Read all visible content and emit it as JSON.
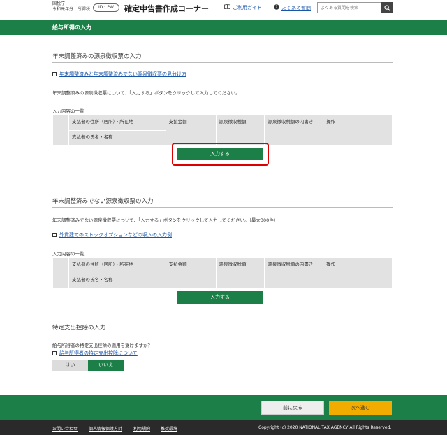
{
  "header": {
    "agency_line1": "国税庁",
    "agency_line2": "令和元年分　所得税",
    "idpw_badge": "ID・PW",
    "title": "確定申告書作成コーナー",
    "guide_link": "ご利用ガイド",
    "faq_link": "よくある質問",
    "search_placeholder": "よくある質問を検索"
  },
  "page_title": "給与所得の入力",
  "section1": {
    "title": "年末調整済みの源泉徴収票の入力",
    "guide_link": "年末調整済みと年末調整済みでない源泉徴収票の見分け方",
    "instruction": "年末調整済みの源泉徴収票について、「入力する」ボタンをクリックして入力してください。",
    "list_label": "入力内容の一覧",
    "enter_button": "入力する"
  },
  "section2": {
    "title": "年末調整済みでない源泉徴収票の入力",
    "instruction": "年末調整済みでない源泉徴収票について、「入力する」ボタンをクリックして入力してください。（最大300件）",
    "guide_link": "外貨建てのストックオプションなどの収入の入力例",
    "list_label": "入力内容の一覧",
    "enter_button": "入力する"
  },
  "table_headers": {
    "payer_address": "支払者の住所（居所）・所在地",
    "payer_name": "支払者の氏名・名称",
    "amount": "支払金額",
    "withholding": "源泉徴収税額",
    "withholding_breakdown": "源泉徴収税額の内書き",
    "operation": "操作"
  },
  "section3": {
    "title": "特定支出控除の入力",
    "question": "給与所得者の特定支出控除の適用を受けますか？",
    "guide_link": "給与所得者の特定支出控除について",
    "yes_label": "はい",
    "no_label": "いいえ",
    "selected": "いいえ"
  },
  "footer": {
    "back_button": "前に戻る",
    "next_button": "次へ進む",
    "links": [
      "お問い合わせ",
      "個人情報保護方針",
      "利用規約",
      "推奨環境"
    ],
    "copyright": "Copyright (c) 2020 NATIONAL TAX AGENCY All Rights Reserved."
  },
  "colors": {
    "brand_green": "#1b7f47",
    "next_orange": "#f2ac00",
    "highlight_red": "#dd0000"
  }
}
